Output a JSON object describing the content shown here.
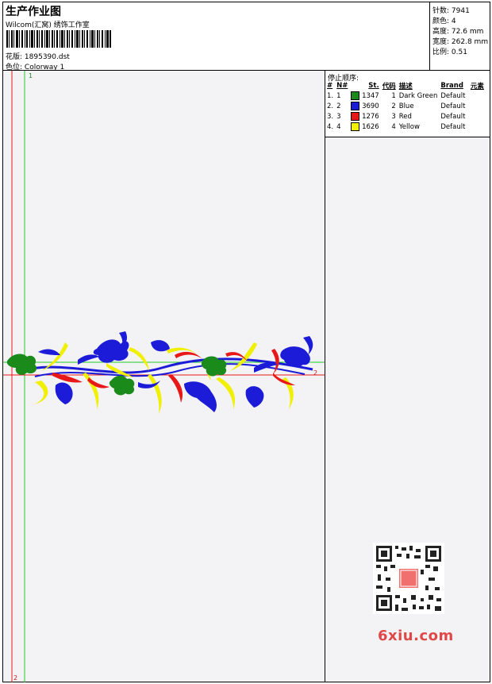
{
  "header": {
    "title": "生产作业图",
    "studio": "Wilcom(汇窝) 绣饰工作室",
    "design_label": "花版:",
    "design_value": "1895390.dst",
    "colorway_label": "色位:",
    "colorway_value": "Colorway 1"
  },
  "stats": [
    {
      "label": "针数:",
      "value": "7941"
    },
    {
      "label": "颜色:",
      "value": "4"
    },
    {
      "label": "高度:",
      "value": "72.6 mm"
    },
    {
      "label": "宽度:",
      "value": "262.8 mm"
    },
    {
      "label": "比例:",
      "value": "0.51"
    }
  ],
  "stop_sequence": {
    "title": "停止顺序:",
    "columns": [
      "#",
      "N#",
      "St.",
      "代码",
      "描述",
      "Brand",
      "元素"
    ],
    "rows": [
      {
        "num": "1.",
        "n": "1",
        "color": "#1a8a1a",
        "stitches": "1347",
        "code": "1",
        "desc": "Dark Green",
        "brand": "Default"
      },
      {
        "num": "2.",
        "n": "2",
        "color": "#1c1cd8",
        "stitches": "3690",
        "code": "2",
        "desc": "Blue",
        "brand": "Default"
      },
      {
        "num": "3.",
        "n": "3",
        "color": "#e81818",
        "stitches": "1276",
        "code": "3",
        "desc": "Red",
        "brand": "Default"
      },
      {
        "num": "4.",
        "n": "4",
        "color": "#f0f000",
        "stitches": "1626",
        "code": "4",
        "desc": "Yellow",
        "brand": "Default"
      }
    ]
  },
  "guides": {
    "green_label": "1",
    "red_label": "2"
  },
  "watermark": {
    "site": "6xiu.com",
    "seal": "印图"
  }
}
